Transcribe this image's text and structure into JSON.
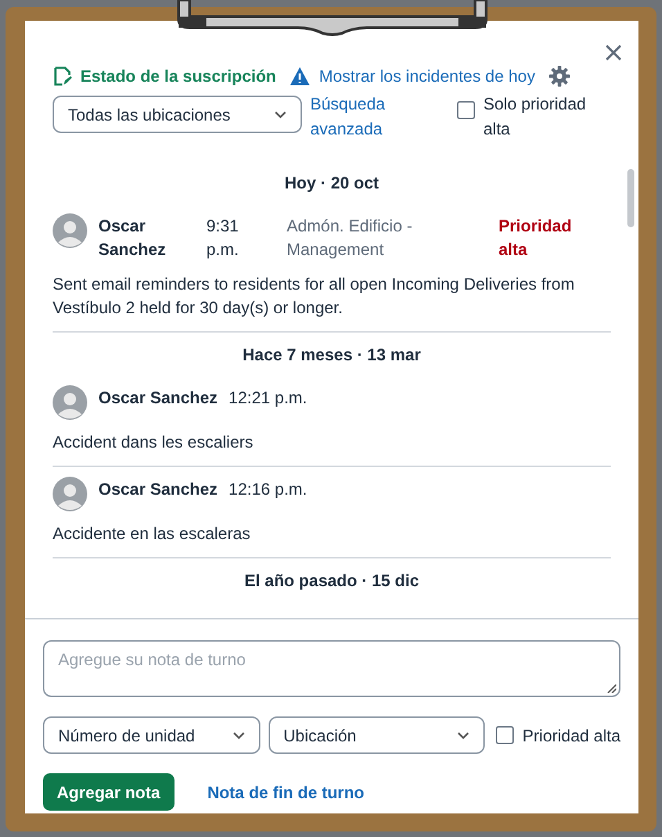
{
  "toolbar": {
    "subscription_link": "Estado de la suscripción",
    "incidents_link": "Mostrar los incidentes de hoy"
  },
  "filters": {
    "location_select": "Todas las ubicaciones",
    "advanced_search": "Búsqueda avanzada",
    "priority_only": {
      "label": "Solo prioridad alta",
      "checked": false
    }
  },
  "groups": [
    {
      "heading": "Hoy · 20 oct",
      "notes": [
        {
          "kind": "full",
          "author": "Oscar Sanchez",
          "time": "9:31 p.m.",
          "location": "Admón. Edificio - Management",
          "priority": "Prioridad alta",
          "text": "Sent email reminders to residents for all open Incoming Deliveries from Vestíbulo 2 held for 30 day(s) or longer."
        }
      ]
    },
    {
      "heading": "Hace 7 meses · 13 mar",
      "notes": [
        {
          "kind": "short",
          "author": "Oscar Sanchez",
          "time": "12:21 p.m.",
          "text": "Accident dans les escaliers"
        },
        {
          "kind": "short",
          "author": "Oscar Sanchez",
          "time": "12:16 p.m.",
          "text": "Accidente en las escaleras"
        }
      ]
    },
    {
      "heading": "El año pasado · 15 dic"
    }
  ],
  "composer": {
    "placeholder": "Agregue su nota de turno",
    "unit_select": "Número de unidad",
    "location_select": "Ubicación",
    "priority": {
      "label": "Prioridad alta",
      "checked": false
    },
    "add_button": "Agregar nota",
    "end_shift_link": "Nota de fin de turno"
  }
}
